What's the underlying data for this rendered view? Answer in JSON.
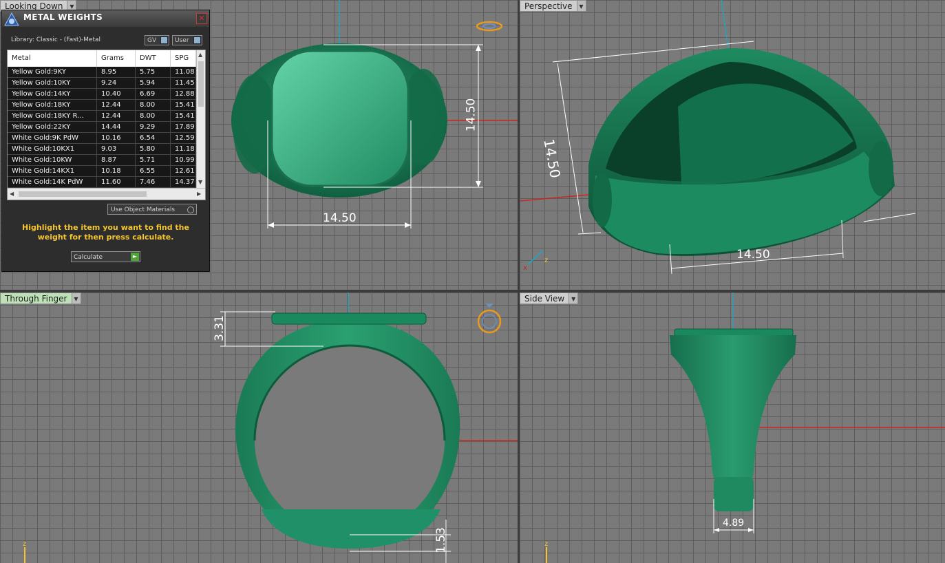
{
  "viewports": {
    "top_left": {
      "label": "Looking Down",
      "dims": {
        "width": "14.50",
        "height": "14.50"
      }
    },
    "top_right": {
      "label": "Perspective",
      "dims": {
        "height": "14.50",
        "width": "14.50"
      }
    },
    "bottom_left": {
      "label": "Through Finger",
      "dims": {
        "top": "3.31",
        "bottom": "1.53"
      }
    },
    "bottom_right": {
      "label": "Side View",
      "dims": {
        "shank": "4.89"
      }
    }
  },
  "axis": {
    "z": "z"
  },
  "dialog": {
    "title": "METAL WEIGHTS",
    "close": "✕",
    "library": "Library: Classic - (Fast)-Metal",
    "gv": "GV",
    "user": "User",
    "columns": [
      "Metal",
      "Grams",
      "DWT",
      "SPG"
    ],
    "rows": [
      [
        "Yellow Gold:9KY",
        "8.95",
        "5.75",
        "11.08"
      ],
      [
        "Yellow Gold:10KY",
        "9.24",
        "5.94",
        "11.45"
      ],
      [
        "Yellow Gold:14KY",
        "10.40",
        "6.69",
        "12.88"
      ],
      [
        "Yellow Gold:18KY",
        "12.44",
        "8.00",
        "15.41"
      ],
      [
        "Yellow Gold:18KY R...",
        "12.44",
        "8.00",
        "15.41"
      ],
      [
        "Yellow Gold:22KY",
        "14.44",
        "9.29",
        "17.89"
      ],
      [
        "White Gold:9K PdW",
        "10.16",
        "6.54",
        "12.59"
      ],
      [
        "White Gold:10KX1",
        "9.03",
        "5.80",
        "11.18"
      ],
      [
        "White Gold:10KW",
        "8.87",
        "5.71",
        "10.99"
      ],
      [
        "White Gold:14KX1",
        "10.18",
        "6.55",
        "12.61"
      ],
      [
        "White Gold:14K PdW",
        "11.60",
        "7.46",
        "14.37"
      ]
    ],
    "use_object_materials": "Use Object Materials",
    "hint": "Highlight the item you want to find the weight for then press calculate.",
    "calculate": "Calculate",
    "go_icon": "►"
  },
  "colors": {
    "metal": "#1e8a60",
    "metal_light": "#3fb58a",
    "highlight": "#f4c431",
    "axis_x": "#c8281e",
    "axis_y": "#2aa0b8"
  }
}
